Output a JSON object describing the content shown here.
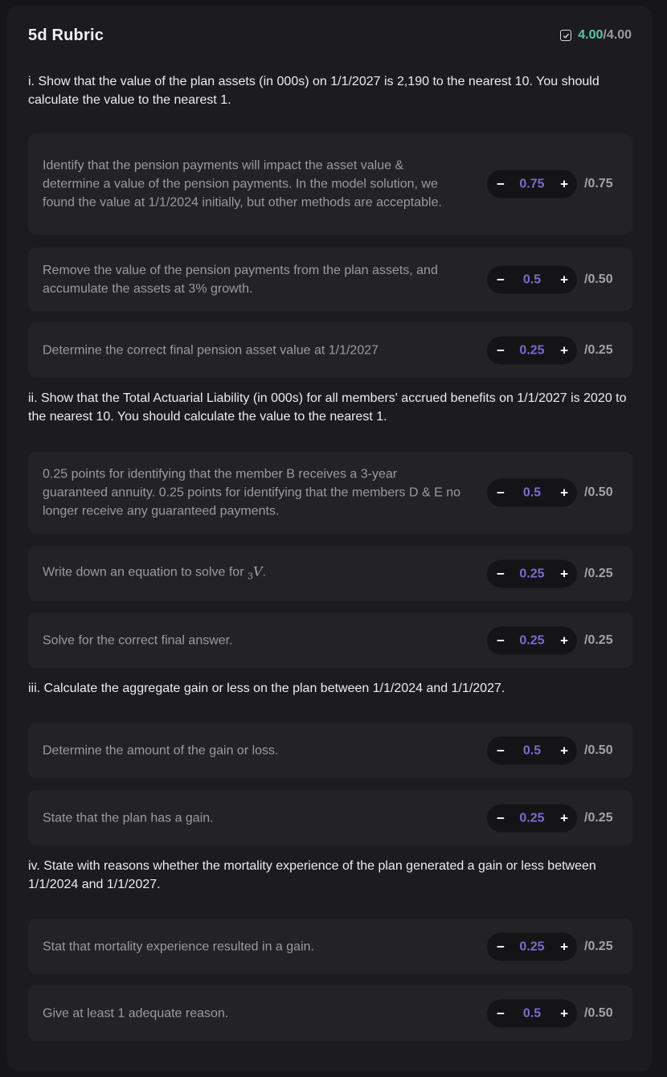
{
  "header": {
    "title": "5d Rubric",
    "score": "4.00",
    "max": "/4.00",
    "colors": {
      "score": "#56c9a4",
      "value": "#7b6bcf"
    }
  },
  "questions": [
    {
      "text": "i. Show that the value of the plan assets (in 000s) on 1/1/2027 is 2,190 to the nearest 10. You should calculate the value to the nearest 1."
    },
    {
      "text": "ii. Show that the Total Actuarial Liability (in 000s) for all members' accrued benefits on 1/1/2027 is 2020 to the nearest 10. You should calculate the value to the nearest 1."
    },
    {
      "text": "iii. Calculate the aggregate gain or less on the plan between 1/1/2024 and 1/1/2027."
    },
    {
      "text": "iv. State with reasons whether the mortality experience of the plan generated a gain or less between 1/1/2024 and 1/1/2027."
    }
  ],
  "criteria": [
    {
      "text": "Identify that the pension payments will impact the asset value & determine a value of the pension payments. In the model solution, we found the value at 1/1/2024 initially, but other methods are acceptable.",
      "value": "0.75",
      "max": "/0.75"
    },
    {
      "text": "Remove the value of the pension payments from the plan assets, and accumulate the assets at 3% growth.",
      "value": "0.5",
      "max": "/0.50"
    },
    {
      "text": "Determine the correct final pension asset value at 1/1/2027",
      "value": "0.25",
      "max": "/0.25"
    },
    {
      "text": "0.25 points for identifying that the member B receives a 3-year guaranteed annuity. 0.25 points for identifying that the members D & E no longer receive any guaranteed payments.",
      "value": "0.5",
      "max": "/0.50"
    },
    {
      "text": "Write down an equation to solve for ",
      "math_sub": "3",
      "math_var": "V",
      "math_after": ".",
      "value": "0.25",
      "max": "/0.25"
    },
    {
      "text": "Solve for the correct final answer.",
      "value": "0.25",
      "max": "/0.25"
    },
    {
      "text": "Determine the amount of the gain or loss.",
      "value": "0.5",
      "max": "/0.50"
    },
    {
      "text": "State that the plan has a gain.",
      "value": "0.25",
      "max": "/0.25"
    },
    {
      "text": "Stat that mortality experience resulted in a gain.",
      "value": "0.25",
      "max": "/0.25"
    },
    {
      "text": "Give at least 1 adequate reason.",
      "value": "0.5",
      "max": "/0.50"
    }
  ],
  "stepper": {
    "minus": "−",
    "plus": "+"
  }
}
